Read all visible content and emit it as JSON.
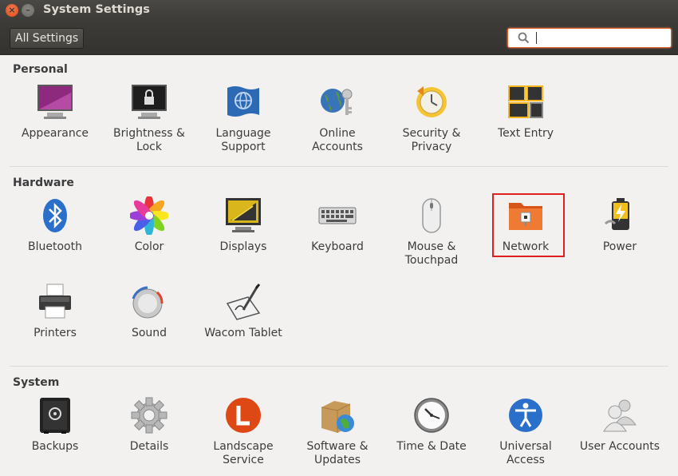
{
  "window": {
    "title": "System Settings",
    "close_glyph": "×",
    "minimize_glyph": "–"
  },
  "toolbar": {
    "all_settings_label": "All Settings",
    "search_placeholder": "",
    "search_value": ""
  },
  "sections": {
    "personal": {
      "title": "Personal",
      "items": [
        {
          "label": "Appearance",
          "icon": "appearance-icon"
        },
        {
          "label": "Brightness &\nLock",
          "icon": "brightness-lock-icon"
        },
        {
          "label": "Language\nSupport",
          "icon": "language-support-icon"
        },
        {
          "label": "Online\nAccounts",
          "icon": "online-accounts-icon"
        },
        {
          "label": "Security &\nPrivacy",
          "icon": "security-privacy-icon"
        },
        {
          "label": "Text Entry",
          "icon": "text-entry-icon"
        }
      ]
    },
    "hardware": {
      "title": "Hardware",
      "items": [
        {
          "label": "Bluetooth",
          "icon": "bluetooth-icon"
        },
        {
          "label": "Color",
          "icon": "color-icon"
        },
        {
          "label": "Displays",
          "icon": "displays-icon"
        },
        {
          "label": "Keyboard",
          "icon": "keyboard-icon"
        },
        {
          "label": "Mouse &\nTouchpad",
          "icon": "mouse-touchpad-icon"
        },
        {
          "label": "Network",
          "icon": "network-icon",
          "highlighted": true
        },
        {
          "label": "Power",
          "icon": "power-icon"
        },
        {
          "label": "Printers",
          "icon": "printers-icon"
        },
        {
          "label": "Sound",
          "icon": "sound-icon"
        },
        {
          "label": "Wacom Tablet",
          "icon": "wacom-tablet-icon"
        }
      ]
    },
    "system": {
      "title": "System",
      "items": [
        {
          "label": "Backups",
          "icon": "backups-icon"
        },
        {
          "label": "Details",
          "icon": "details-icon"
        },
        {
          "label": "Landscape\nService",
          "icon": "landscape-service-icon"
        },
        {
          "label": "Software &\nUpdates",
          "icon": "software-updates-icon"
        },
        {
          "label": "Time & Date",
          "icon": "time-date-icon"
        },
        {
          "label": "Universal\nAccess",
          "icon": "universal-access-icon"
        },
        {
          "label": "User Accounts",
          "icon": "user-accounts-icon"
        }
      ]
    }
  },
  "colors": {
    "accent": "#e0642e",
    "highlight_border": "#e02020",
    "titlebar": "#3c3b37",
    "background": "#f2f1f0"
  }
}
